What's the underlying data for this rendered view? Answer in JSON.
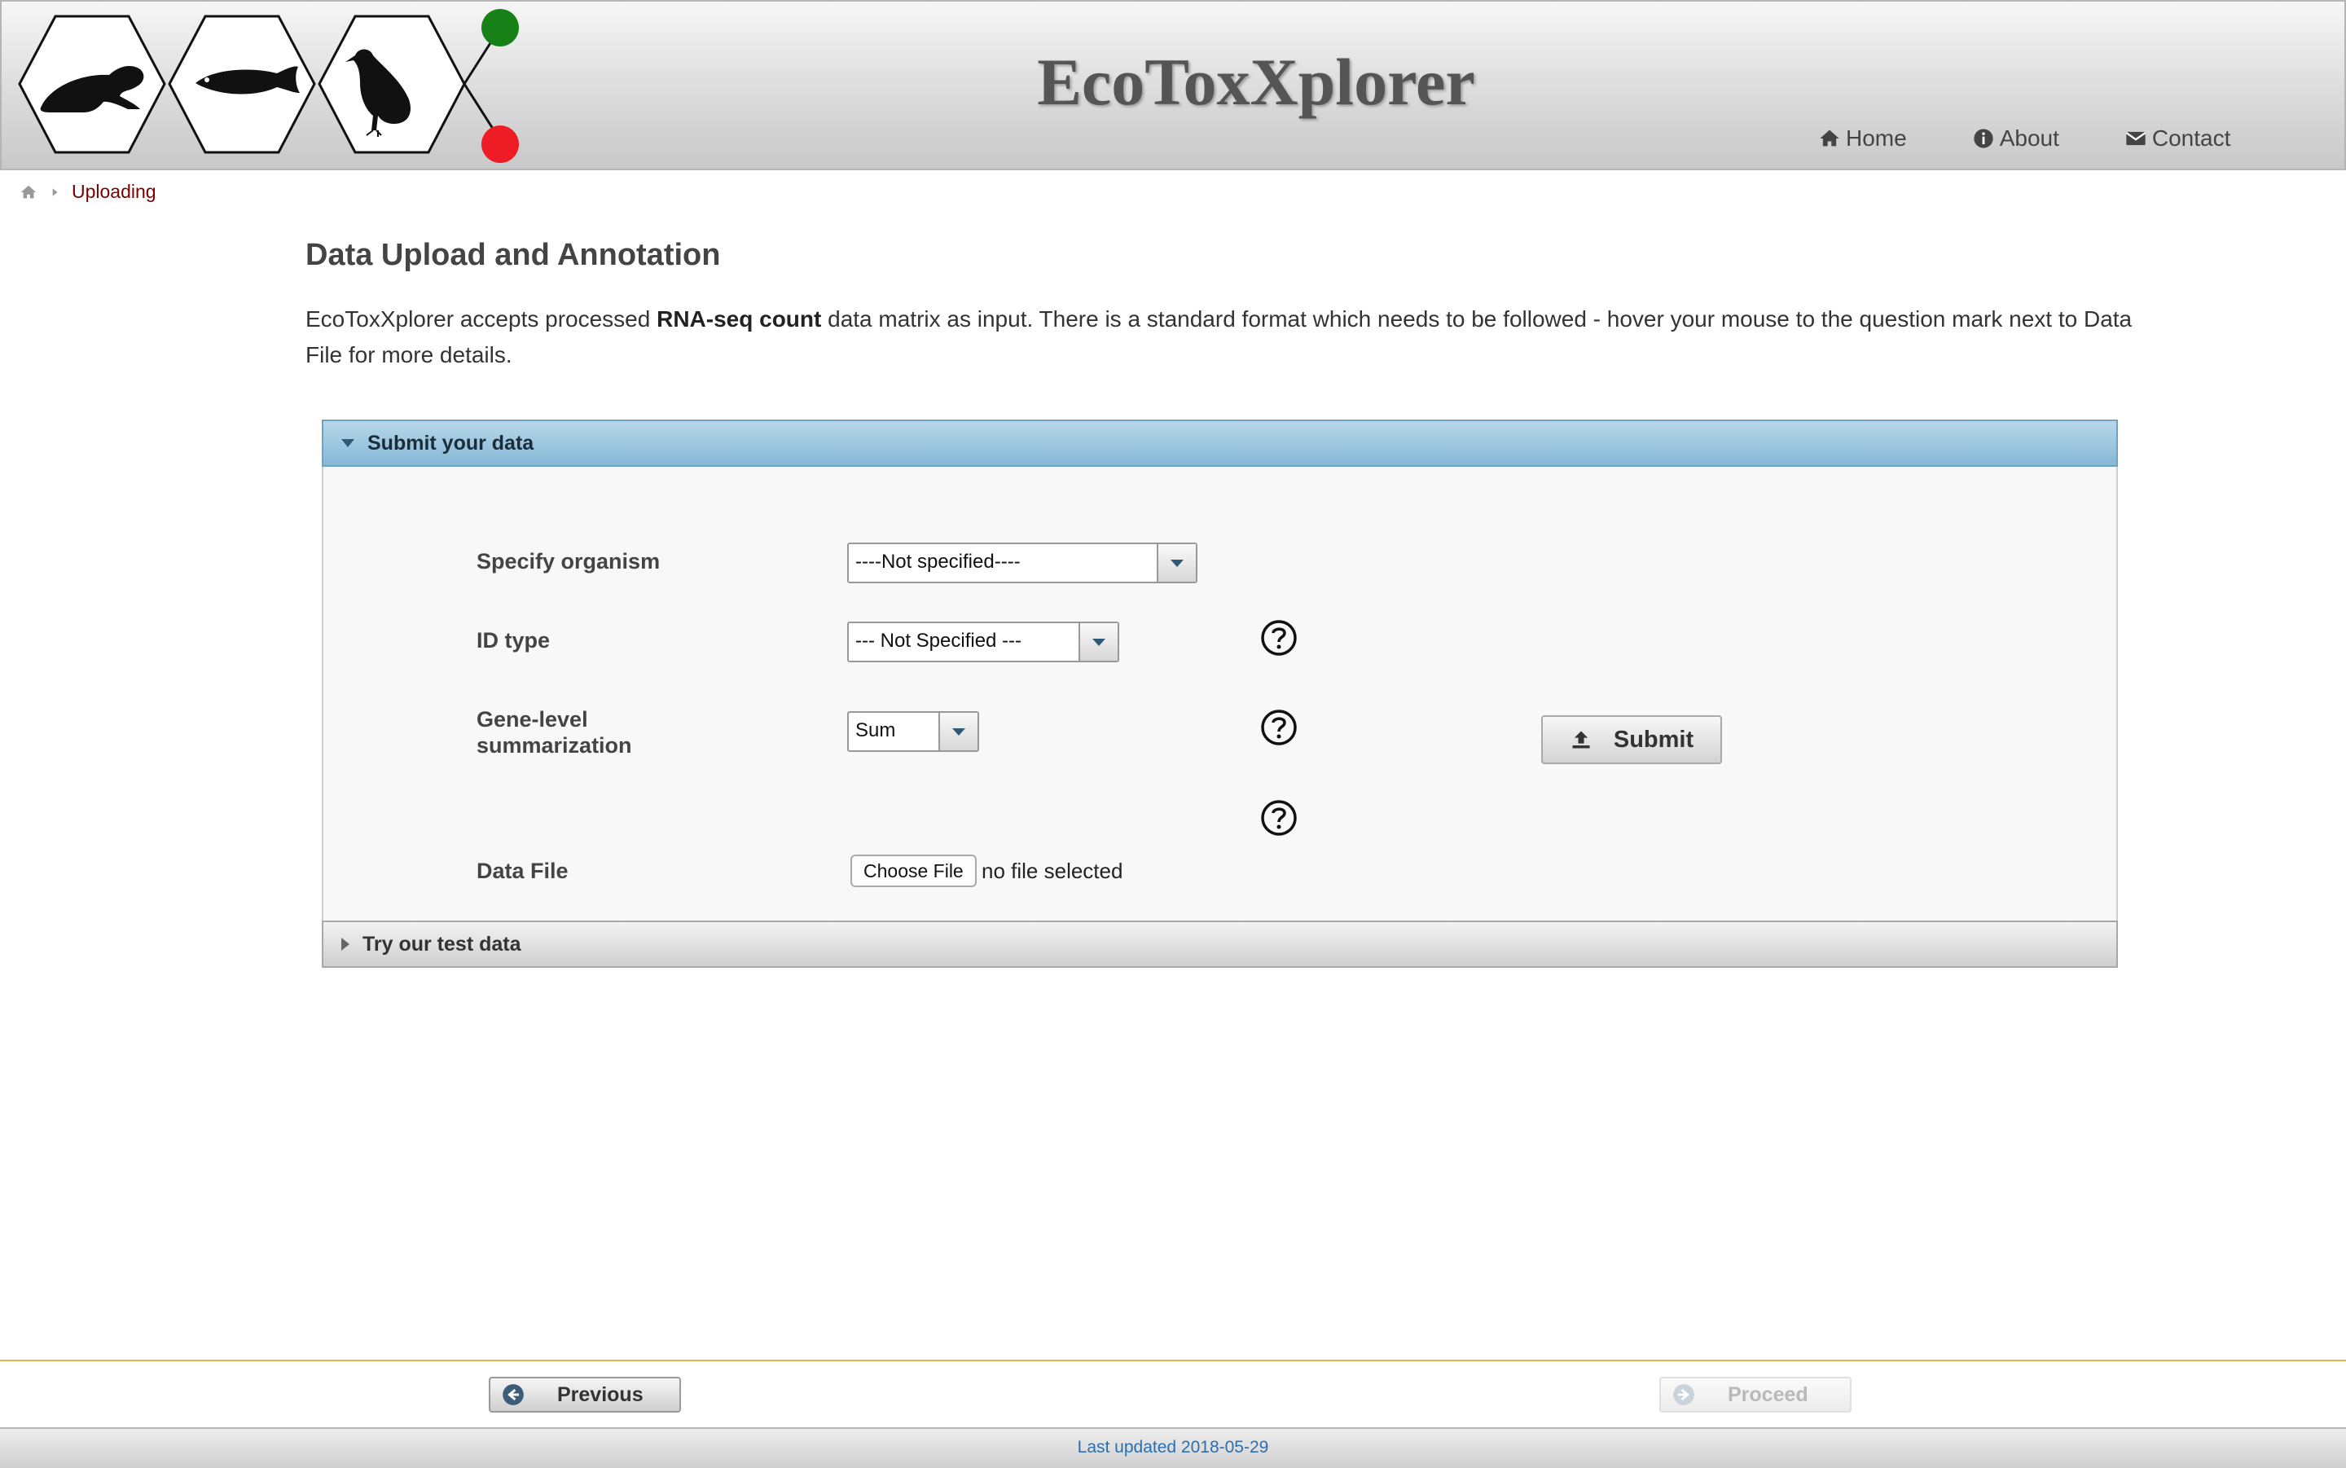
{
  "header": {
    "app_title": "EcoToxXplorer",
    "nav": [
      {
        "label": "Home",
        "icon": "home-icon"
      },
      {
        "label": "About",
        "icon": "info-icon"
      },
      {
        "label": "Contact",
        "icon": "envelope-icon"
      }
    ],
    "logo_colors": {
      "top_dot": "#178017",
      "bottom_dot": "#ee1c25"
    }
  },
  "breadcrumb": {
    "current": "Uploading"
  },
  "main": {
    "title": "Data Upload and Annotation",
    "intro_part1": "EcoToxXplorer accepts processed ",
    "intro_bold": "RNA-seq count",
    "intro_part2": " data matrix as input. There is a standard format which needs to be followed - hover your mouse to the question mark next to Data File for more details."
  },
  "panel": {
    "submit_header": "Submit your data",
    "test_header": "Try our test data",
    "fields": {
      "organism": {
        "label": "Specify organism",
        "value": "----Not specified----"
      },
      "id_type": {
        "label": "ID type",
        "value": "--- Not Specified ---"
      },
      "summarization": {
        "label_line1": "Gene-level",
        "label_line2": "summarization",
        "value": "Sum"
      },
      "data_file": {
        "label": "Data File",
        "button": "Choose File",
        "status": "no file selected"
      }
    },
    "submit_label": "Submit"
  },
  "footer": {
    "previous_label": "Previous",
    "proceed_label": "Proceed",
    "last_updated": "Last updated 2018-05-29"
  },
  "colors": {
    "accent_header": "#86b8d6",
    "divider": "#f0b24e",
    "link": "#2a6fb0",
    "breadcrumb": "#7a0000"
  }
}
